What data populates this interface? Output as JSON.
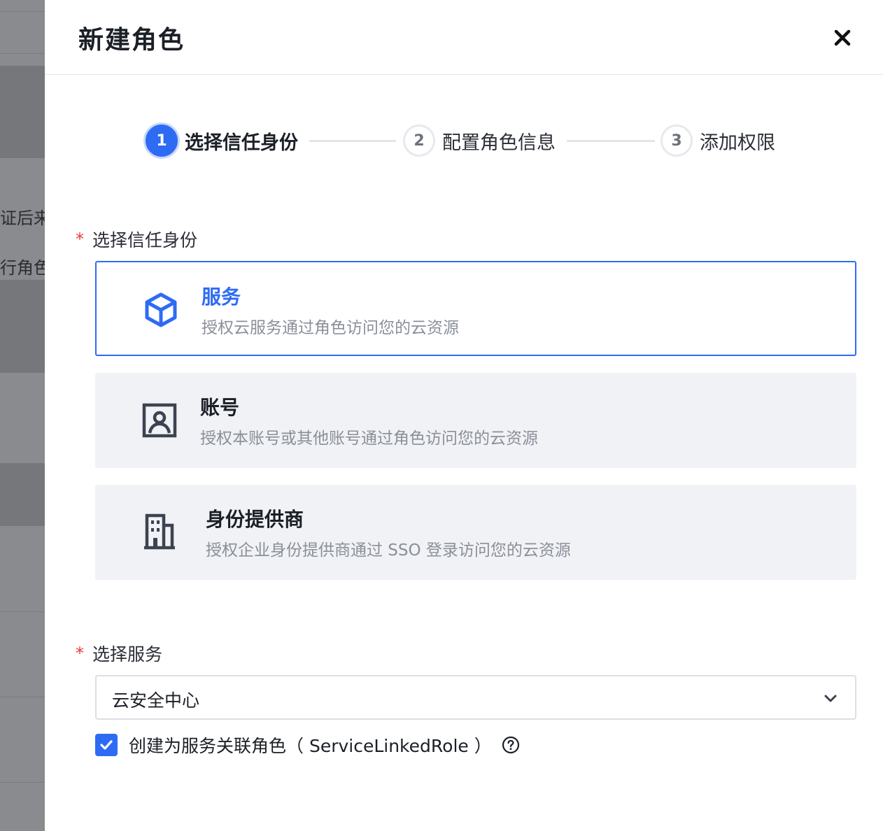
{
  "background": {
    "fragments": [
      "证后来",
      "行角色"
    ]
  },
  "drawer": {
    "title": "新建角色",
    "close_icon": "close-icon"
  },
  "steps": [
    {
      "number": "1",
      "label": "选择信任身份",
      "state": "active"
    },
    {
      "number": "2",
      "label": "配置角色信息",
      "state": "pending"
    },
    {
      "number": "3",
      "label": "添加权限",
      "state": "pending"
    }
  ],
  "trust": {
    "required_mark": "*",
    "label": "选择信任身份",
    "options": [
      {
        "icon": "cube-icon",
        "title": "服务",
        "desc": "授权云服务通过角色访问您的云资源",
        "selected": true
      },
      {
        "icon": "account-icon",
        "title": "账号",
        "desc": "授权本账号或其他账号通过角色访问您的云资源",
        "selected": false
      },
      {
        "icon": "building-icon",
        "title": "身份提供商",
        "desc": "授权企业身份提供商通过 SSO 登录访问您的云资源",
        "selected": false
      }
    ]
  },
  "service": {
    "required_mark": "*",
    "label": "选择服务",
    "selected_value": "云安全中心",
    "chevron_icon": "chevron-down-icon"
  },
  "linked_role": {
    "checked": true,
    "label": "创建为服务关联角色（ ServiceLinkedRole ）",
    "help_icon": "question-circle-icon"
  },
  "colors": {
    "primary": "#2e6bf5",
    "required": "#e83a3a",
    "card_bg": "#f1f2f6"
  }
}
